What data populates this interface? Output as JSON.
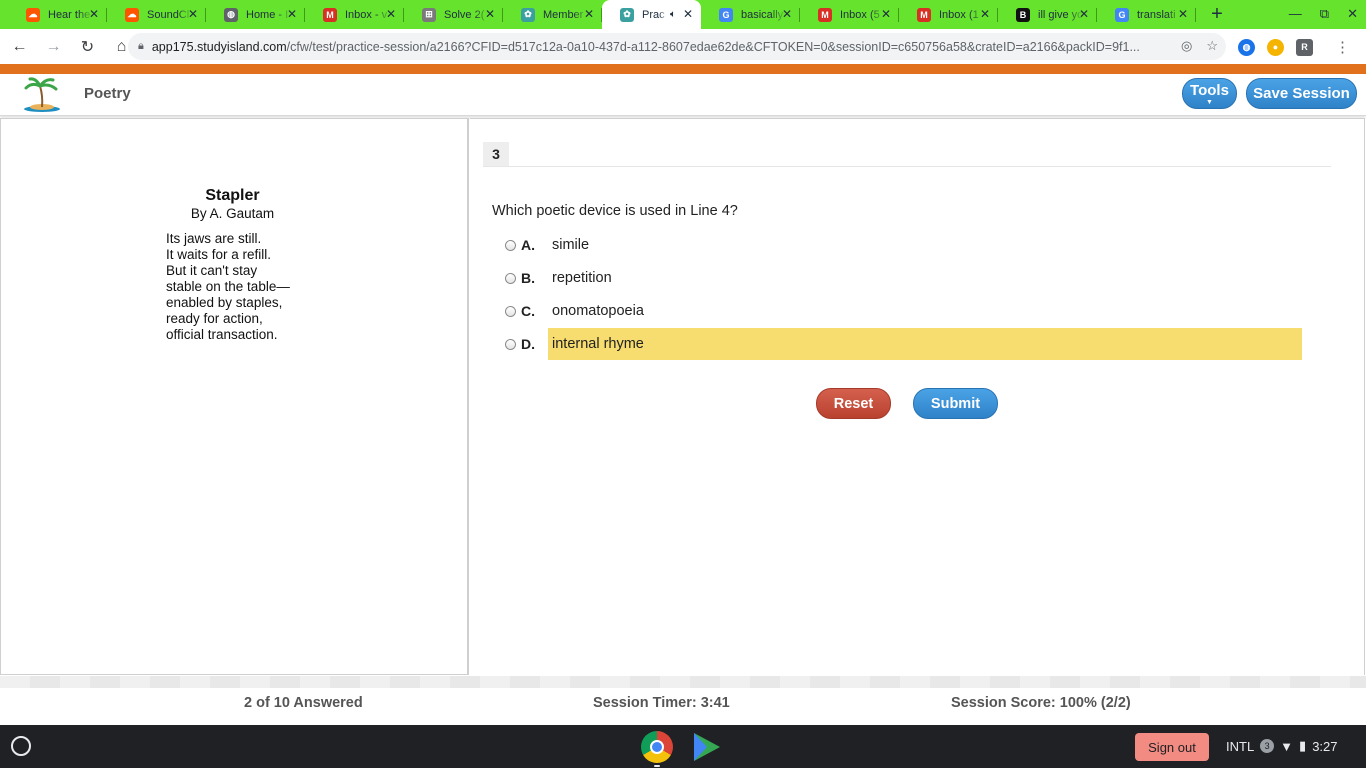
{
  "browser": {
    "tabs": [
      {
        "title": "Hear the",
        "icon": "soundcloud-icon",
        "color": "#ff5500",
        "glyph": "☁"
      },
      {
        "title": "SoundCl",
        "icon": "soundcloud-icon",
        "color": "#ff5500",
        "glyph": "☁"
      },
      {
        "title": "Home - I",
        "icon": "globe-icon",
        "color": "#5f6368",
        "glyph": "◍"
      },
      {
        "title": "Inbox - v",
        "icon": "gmail-icon",
        "color": "#d93025",
        "glyph": "M"
      },
      {
        "title": "Solve 2(",
        "icon": "math-icon",
        "color": "#7a7a7a",
        "glyph": "⊞"
      },
      {
        "title": "Member",
        "icon": "studyisland-icon",
        "color": "#3aa0a0",
        "glyph": "✿"
      },
      {
        "title": "Prac",
        "icon": "studyisland-icon",
        "color": "#3aa0a0",
        "glyph": "✿",
        "active": true,
        "audio": true
      },
      {
        "title": "basically",
        "icon": "google-icon",
        "color": "#4285f4",
        "glyph": "G"
      },
      {
        "title": "Inbox (5",
        "icon": "gmail-icon",
        "color": "#d93025",
        "glyph": "M"
      },
      {
        "title": "Inbox (1",
        "icon": "gmail-icon",
        "color": "#d93025",
        "glyph": "M"
      },
      {
        "title": "ill give yo",
        "icon": "brainly-icon",
        "color": "#111111",
        "glyph": "B"
      },
      {
        "title": "translati",
        "icon": "google-icon",
        "color": "#4285f4",
        "glyph": "G"
      }
    ],
    "url_host": "app175.studyisland.com",
    "url_path": "/cfw/test/practice-session/a2166?CFID=d517c12a-0a10-437d-a112-8607edae62de&CFTOKEN=0&sessionID=c650756a58&crateID=a2166&packID=9f1..."
  },
  "header": {
    "subject": "Poetry",
    "tools_label": "Tools",
    "save_label": "Save Session"
  },
  "poem": {
    "title": "Stapler",
    "author": "By A. Gautam",
    "lines": [
      "Its jaws are still.",
      "It waits for a refill.",
      "But it can't stay",
      "stable on the table—",
      "enabled by staples,",
      "ready for action,",
      "official transaction."
    ]
  },
  "question": {
    "number": "3",
    "prompt": "Which poetic device is used in Line 4?",
    "choices": [
      {
        "letter": "A.",
        "text": "simile",
        "highlighted": false
      },
      {
        "letter": "B.",
        "text": "repetition",
        "highlighted": false
      },
      {
        "letter": "C.",
        "text": "onomatopoeia",
        "highlighted": false
      },
      {
        "letter": "D.",
        "text": "internal rhyme",
        "highlighted": true
      }
    ],
    "reset_label": "Reset",
    "submit_label": "Submit"
  },
  "status": {
    "answered": "2 of 10 Answered",
    "timer": "Session Timer: 3:41",
    "score": "Session Score: 100% (2/2)"
  },
  "shelf": {
    "signout_label": "Sign out",
    "input_method": "INTL",
    "notification_count": "3",
    "time": "3:27"
  },
  "colors": {
    "tabstrip": "#66e32c",
    "brand_orange": "#e2711d",
    "highlight": "#f7dc6f",
    "primary_button": "#2f82c8",
    "reset_button": "#c0473a"
  }
}
